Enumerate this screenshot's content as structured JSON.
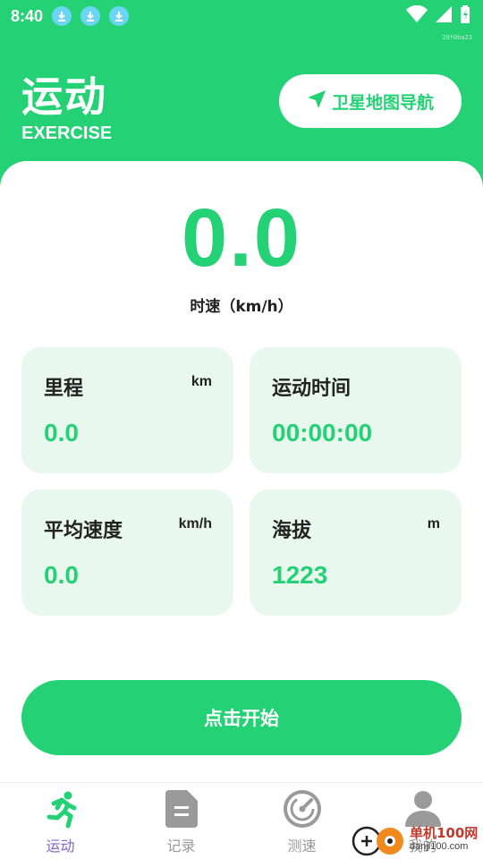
{
  "status_bar": {
    "time": "8:40",
    "left_icons": [
      "download-icon",
      "download-icon",
      "download-icon"
    ],
    "right_icons": [
      "wifi-icon",
      "signal-icon",
      "battery-icon"
    ],
    "corner_tag": "28f0ba23"
  },
  "header": {
    "title": "运动",
    "subtitle": "EXERCISE",
    "nav_button_label": "卫星地图导航",
    "nav_button_icon": "navigation-arrow-icon"
  },
  "speed": {
    "value": "0.0",
    "label": "时速（km/h）"
  },
  "stats": [
    {
      "label": "里程",
      "unit": "km",
      "value": "0.0"
    },
    {
      "label": "运动时间",
      "unit": "",
      "value": "00:00:00"
    },
    {
      "label": "平均速度",
      "unit": "km/h",
      "value": "0.0"
    },
    {
      "label": "海拔",
      "unit": "m",
      "value": "1223"
    }
  ],
  "start_button": {
    "label": "点击开始"
  },
  "tabs": [
    {
      "label": "运动",
      "icon": "running-icon",
      "active": true
    },
    {
      "label": "记录",
      "icon": "document-icon",
      "active": false
    },
    {
      "label": "测速",
      "icon": "speedometer-icon",
      "active": false
    },
    {
      "label": "我的",
      "icon": "user-icon",
      "active": false
    }
  ],
  "watermark": {
    "name": "单机100网",
    "domain": "danji100.com"
  },
  "colors": {
    "brand_green": "#24d275",
    "tile_bg": "#e9f8ef",
    "active_tab": "#7b68c9",
    "inactive_tab": "#999999"
  }
}
